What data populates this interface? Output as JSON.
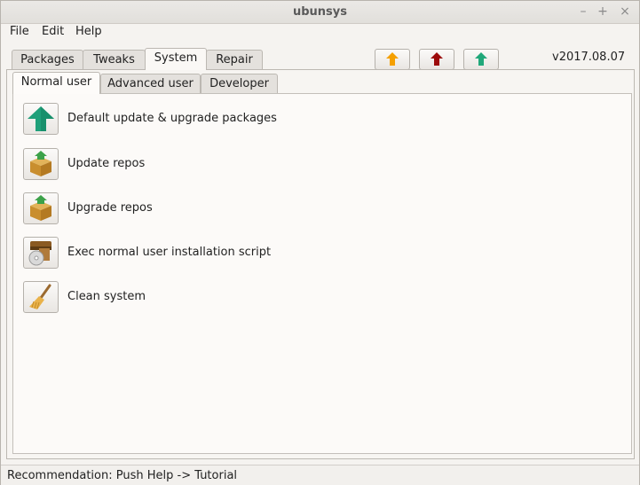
{
  "window": {
    "title": "ubunsys",
    "minimize": "–",
    "maximize": "+",
    "close": "×"
  },
  "menu": {
    "file": "File",
    "edit": "Edit",
    "help": "Help"
  },
  "main_tabs": [
    {
      "label": "Packages"
    },
    {
      "label": "Tweaks"
    },
    {
      "label": "System"
    },
    {
      "label": "Repair"
    }
  ],
  "toolbar": {
    "icons": [
      "orange-up-arrow-icon",
      "red-up-arrow-icon",
      "green-up-arrow-icon"
    ],
    "colors": [
      "#f5a000",
      "#9c0b0b",
      "#20a87a"
    ],
    "version": "v2017.08.07"
  },
  "sub_tabs": [
    {
      "label": "Normal user"
    },
    {
      "label": "Advanced user"
    },
    {
      "label": "Developer"
    }
  ],
  "actions": [
    {
      "label": "Default update & upgrade packages",
      "icon": "green-up-arrow-icon"
    },
    {
      "label": "Update repos",
      "icon": "package-download-icon"
    },
    {
      "label": "Upgrade repos",
      "icon": "package-download-icon"
    },
    {
      "label": "Exec normal user installation script",
      "icon": "installer-disc-icon"
    },
    {
      "label": "Clean system",
      "icon": "broom-icon"
    }
  ],
  "status": {
    "text": "Recommendation: Push Help -> Tutorial"
  }
}
